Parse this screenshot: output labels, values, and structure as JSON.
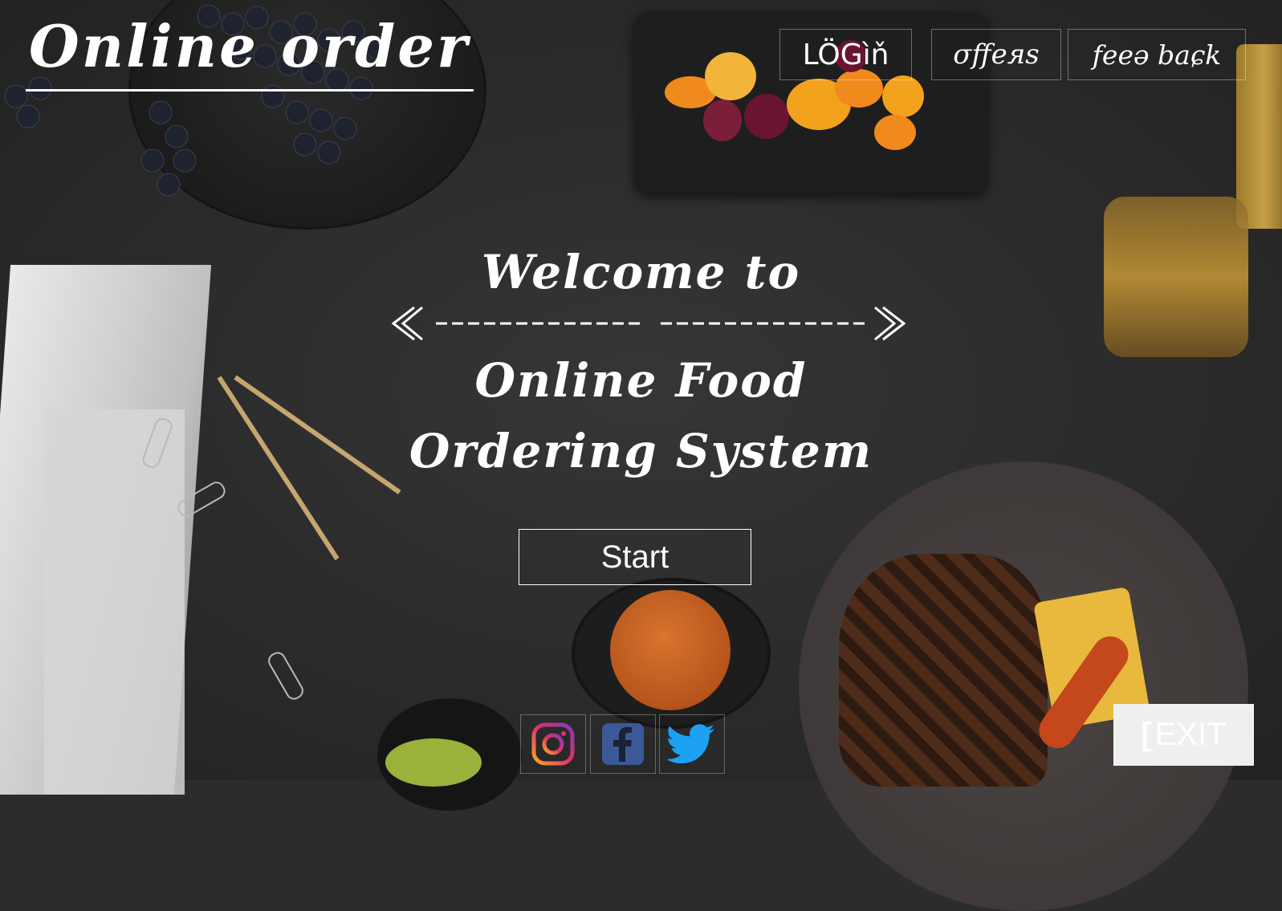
{
  "header": {
    "logo_text": "Online order"
  },
  "nav": {
    "login": "LÖGìň",
    "offers": "σffeяs",
    "feedback": "feeə baɕk"
  },
  "welcome": {
    "line1": "Welcome to",
    "line2": "Online Food",
    "line3": "Ordering System",
    "divider_left": "<-----------",
    "divider_right": "---------->"
  },
  "actions": {
    "start_label": "Start",
    "exit_label": "EXIT",
    "exit_prefix": "["
  },
  "social": {
    "items": [
      {
        "name": "instagram-icon",
        "color": "#e1306c"
      },
      {
        "name": "facebook-icon",
        "color": "#3b5998"
      },
      {
        "name": "twitter-icon",
        "color": "#1da1f2"
      }
    ]
  },
  "colors": {
    "background": "#2c2c2c",
    "text": "#ffffff"
  }
}
